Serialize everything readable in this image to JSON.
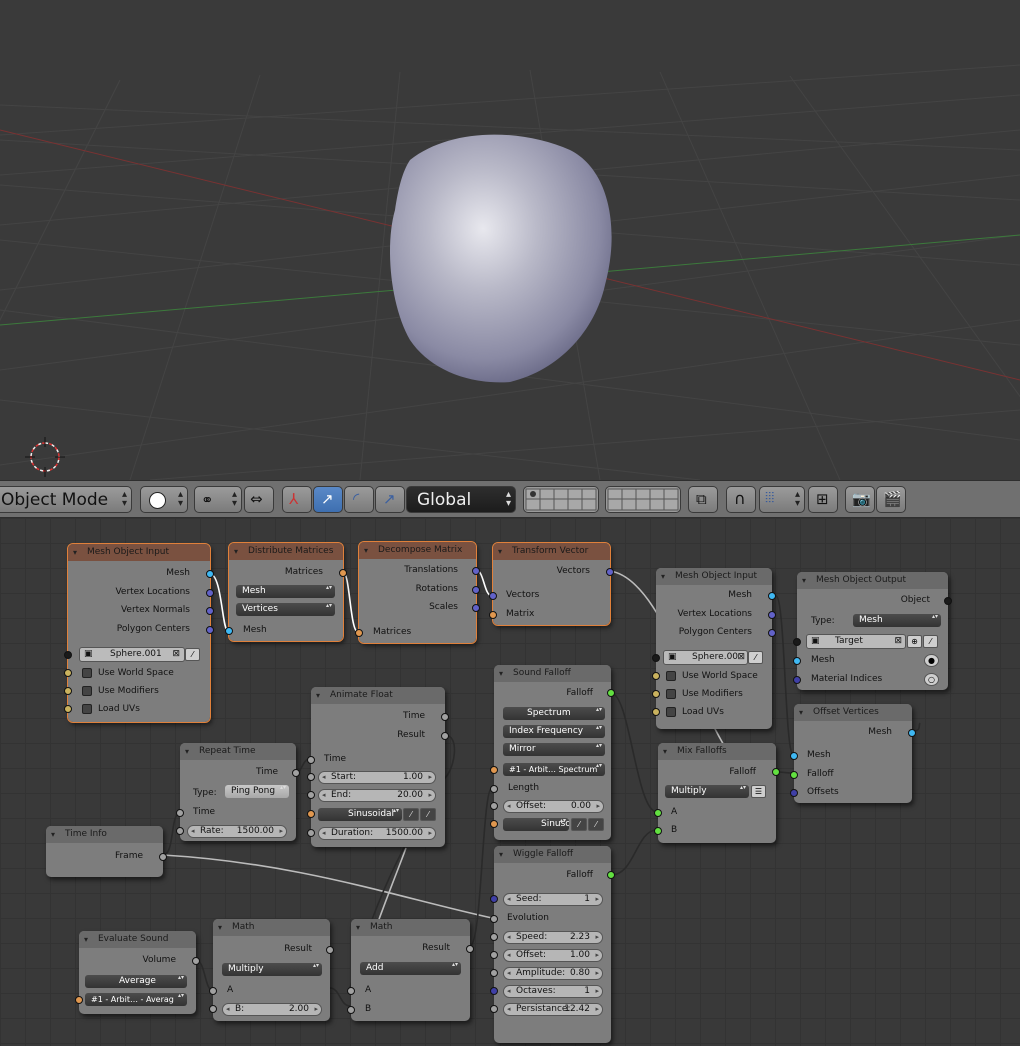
{
  "header": {
    "mode": "Object Mode",
    "orientation": "Global"
  },
  "nodes": {
    "mesh_object_input_1": {
      "title": "Mesh Object Input",
      "outputs": [
        "Mesh",
        "Vertex Locations",
        "Vertex Normals",
        "Polygon Centers"
      ],
      "object": "Sphere.001",
      "options": [
        "Use World Space",
        "Use Modifiers",
        "Load UVs"
      ]
    },
    "distribute_matrices": {
      "title": "Distribute Matrices",
      "output": "Matrices",
      "dd1": "Mesh",
      "dd2": "Vertices",
      "input": "Mesh"
    },
    "decompose_matrix": {
      "title": "Decompose Matrix",
      "outputs": [
        "Translations",
        "Rotations",
        "Scales"
      ],
      "input": "Matrices"
    },
    "transform_vector": {
      "title": "Transform Vector",
      "output": "Vectors",
      "inputs": [
        "Vectors",
        "Matrix"
      ]
    },
    "mesh_object_input_2": {
      "title": "Mesh Object Input",
      "outputs": [
        "Mesh",
        "Vertex Locations",
        "Polygon Centers"
      ],
      "object": "Sphere.00",
      "options": [
        "Use World Space",
        "Use Modifiers",
        "Load UVs"
      ]
    },
    "mesh_object_output": {
      "title": "Mesh Object Output",
      "output": "Object",
      "type_label": "Type:",
      "type_value": "Mesh",
      "target": "Target",
      "inputs": [
        "Mesh",
        "Material Indices"
      ]
    },
    "sound_falloff": {
      "title": "Sound Falloff",
      "output": "Falloff",
      "dd1": "Spectrum",
      "dd2": "Index Frequency",
      "dd3": "Mirror",
      "sound": "#1 - Arbit… Spectrum",
      "length": "Length",
      "offset_label": "Offset:",
      "offset_value": "0.00",
      "interp": "Sinusoi"
    },
    "animate_float": {
      "title": "Animate Float",
      "outputs": [
        "Time",
        "Result"
      ],
      "input": "Time",
      "start_label": "Start:",
      "start_value": "1.00",
      "end_label": "End:",
      "end_value": "20.00",
      "interp": "Sinusoidal",
      "duration_label": "Duration:",
      "duration_value": "1500.00"
    },
    "repeat_time": {
      "title": "Repeat Time",
      "output": "Time",
      "type_label": "Type:",
      "type_value": "Ping Pong",
      "input": "Time",
      "rate_label": "Rate:",
      "rate_value": "1500.00"
    },
    "time_info": {
      "title": "Time Info",
      "output": "Frame"
    },
    "mix_falloffs": {
      "title": "Mix Falloffs",
      "output": "Falloff",
      "mode": "Multiply",
      "inputs": [
        "A",
        "B"
      ]
    },
    "offset_vertices": {
      "title": "Offset Vertices",
      "output": "Mesh",
      "inputs": [
        "Mesh",
        "Falloff",
        "Offsets"
      ]
    },
    "wiggle_falloff": {
      "title": "Wiggle Falloff",
      "output": "Falloff",
      "seed_label": "Seed:",
      "seed_value": "1",
      "evolution": "Evolution",
      "speed_label": "Speed:",
      "speed_value": "2.23",
      "offset_label": "Offset:",
      "offset_value": "1.00",
      "amp_label": "Amplitude:",
      "amp_value": "0.80",
      "oct_label": "Octaves:",
      "oct_value": "1",
      "pers_label": "Persistance:",
      "pers_value": "12.42"
    },
    "evaluate_sound": {
      "title": "Evaluate Sound",
      "output": "Volume",
      "mode": "Average",
      "sound": "#1 - Arbit… - Averag"
    },
    "math_1": {
      "title": "Math",
      "output": "Result",
      "op": "Multiply",
      "a": "A",
      "b_label": "B:",
      "b_value": "2.00"
    },
    "math_2": {
      "title": "Math",
      "output": "Result",
      "op": "Add",
      "a": "A",
      "b": "B"
    }
  },
  "colors": {
    "selected_outline": "#e0803a",
    "socket_mesh": "#3fb8f3",
    "socket_vector": "#6262c8",
    "socket_falloff": "#62e040",
    "socket_float": "#a1a1a1",
    "socket_bool": "#c9b25e"
  }
}
